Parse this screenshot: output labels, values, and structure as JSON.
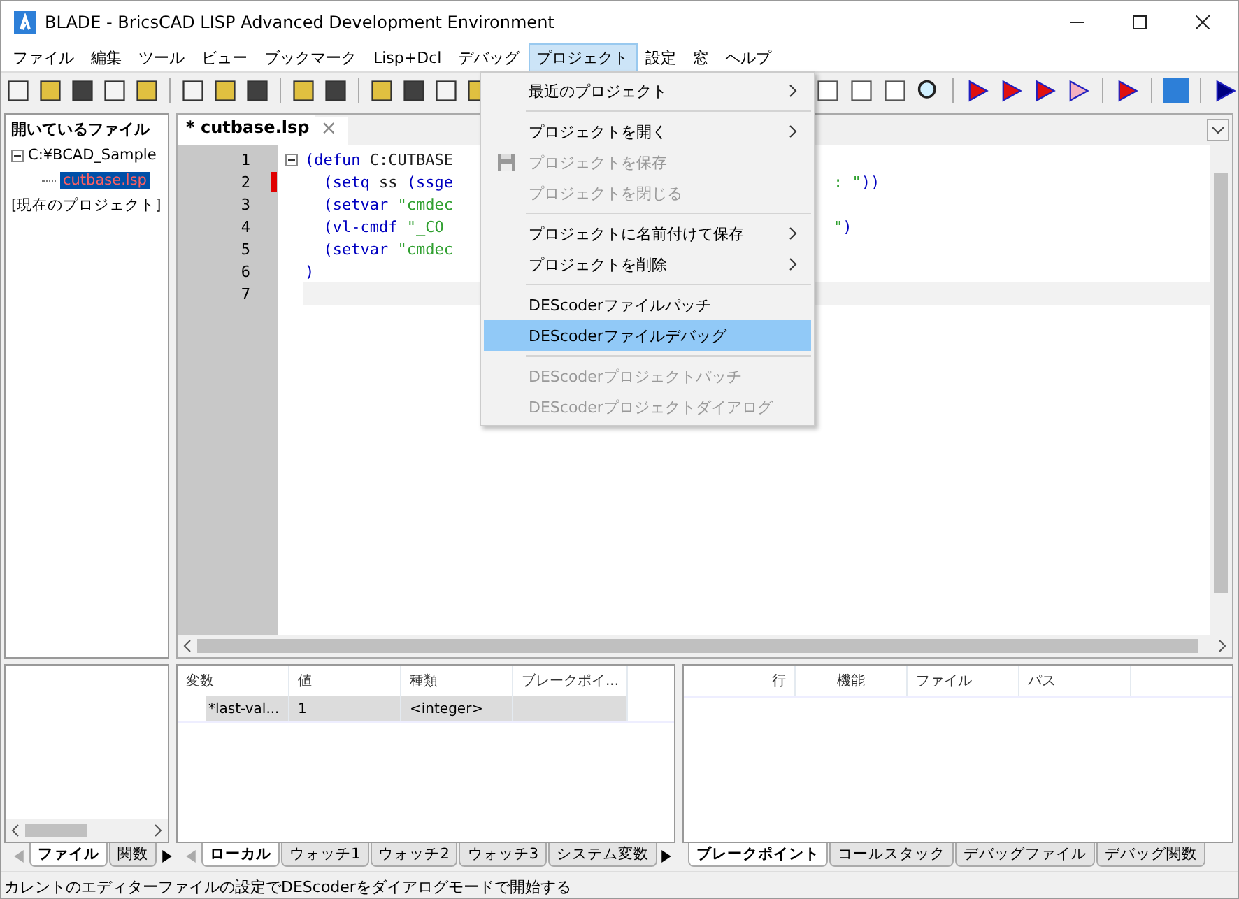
{
  "window": {
    "title": "BLADE - BricsCAD LISP Advanced Development Environment"
  },
  "menubar": [
    {
      "label": "ファイル",
      "selected": false
    },
    {
      "label": "編集",
      "selected": false
    },
    {
      "label": "ツール",
      "selected": false
    },
    {
      "label": "ビュー",
      "selected": false
    },
    {
      "label": "ブックマーク",
      "selected": false
    },
    {
      "label": "Lisp+Dcl",
      "selected": false
    },
    {
      "label": "デバッグ",
      "selected": false
    },
    {
      "label": "プロジェクト",
      "selected": true
    },
    {
      "label": "設定",
      "selected": false
    },
    {
      "label": "窓",
      "selected": false
    },
    {
      "label": "ヘルプ",
      "selected": false
    }
  ],
  "project_menu": [
    {
      "kind": "item",
      "label": "最近のプロジェクト",
      "submenu": true,
      "disabled": false,
      "selected": false,
      "icon": false
    },
    {
      "kind": "separator"
    },
    {
      "kind": "item",
      "label": "プロジェクトを開く",
      "submenu": true,
      "disabled": false,
      "selected": false,
      "icon": false
    },
    {
      "kind": "item",
      "label": "プロジェクトを保存",
      "submenu": false,
      "disabled": true,
      "selected": false,
      "icon": true
    },
    {
      "kind": "item",
      "label": "プロジェクトを閉じる",
      "submenu": false,
      "disabled": true,
      "selected": false,
      "icon": false
    },
    {
      "kind": "separator"
    },
    {
      "kind": "item",
      "label": "プロジェクトに名前付けて保存",
      "submenu": true,
      "disabled": false,
      "selected": false,
      "icon": false
    },
    {
      "kind": "item",
      "label": "プロジェクトを削除",
      "submenu": true,
      "disabled": false,
      "selected": false,
      "icon": false
    },
    {
      "kind": "separator"
    },
    {
      "kind": "item",
      "label": "DEScoderファイルパッチ",
      "submenu": false,
      "disabled": false,
      "selected": false,
      "icon": false
    },
    {
      "kind": "item",
      "label": "DEScoderファイルデバッグ",
      "submenu": false,
      "disabled": false,
      "selected": true,
      "icon": false
    },
    {
      "kind": "separator"
    },
    {
      "kind": "item",
      "label": "DEScoderプロジェクトパッチ",
      "submenu": false,
      "disabled": true,
      "selected": false,
      "icon": false
    },
    {
      "kind": "item",
      "label": "DEScoderプロジェクトダイアログ",
      "submenu": false,
      "disabled": true,
      "selected": false,
      "icon": false
    }
  ],
  "file_panel": {
    "title": "開いているファイル",
    "tree": [
      {
        "label": "C:¥BCAD_Sample",
        "expanded": true,
        "selected": false,
        "children": [
          {
            "label": "cutbase.lsp",
            "selected": true
          }
        ]
      },
      {
        "label": "[現在のプロジェクト]",
        "selected": false
      }
    ],
    "tabs": [
      {
        "label": "ファイル",
        "selected": true
      },
      {
        "label": "関数",
        "selected": false
      }
    ]
  },
  "editor": {
    "tab": {
      "label": "* cutbase.lsp",
      "close": "×"
    },
    "lines": [
      {
        "number": "1",
        "breakpoint": false,
        "current": false,
        "left": [
          {
            "kind": "paren",
            "text": "("
          },
          {
            "kind": "func",
            "text": "defun"
          },
          {
            "kind": "sym",
            "text": " C:CUTBASE"
          }
        ]
      },
      {
        "number": "2",
        "breakpoint": true,
        "current": false,
        "left": [
          {
            "kind": "paren",
            "text": "  ("
          },
          {
            "kind": "func",
            "text": "setq"
          },
          {
            "kind": "sym",
            "text": " ss "
          },
          {
            "kind": "paren",
            "text": "("
          },
          {
            "kind": "func",
            "text": "ssge"
          }
        ],
        "right": [
          {
            "kind": "str",
            "text": ": \""
          },
          {
            "kind": "paren",
            "text": "))"
          }
        ]
      },
      {
        "number": "3",
        "breakpoint": false,
        "current": false,
        "left": [
          {
            "kind": "paren",
            "text": "  ("
          },
          {
            "kind": "func",
            "text": "setvar"
          },
          {
            "kind": "str",
            "text": " \"cmdec"
          }
        ]
      },
      {
        "number": "4",
        "breakpoint": false,
        "current": false,
        "left": [
          {
            "kind": "paren",
            "text": "  ("
          },
          {
            "kind": "func",
            "text": "vl-cmdf"
          },
          {
            "kind": "str",
            "text": " \"_CO"
          }
        ],
        "right": [
          {
            "kind": "str",
            "text": "\""
          },
          {
            "kind": "paren",
            "text": ")"
          }
        ]
      },
      {
        "number": "5",
        "breakpoint": false,
        "current": false,
        "left": [
          {
            "kind": "paren",
            "text": "  ("
          },
          {
            "kind": "func",
            "text": "setvar"
          },
          {
            "kind": "str",
            "text": " \"cmdec"
          }
        ]
      },
      {
        "number": "6",
        "breakpoint": false,
        "current": false,
        "left": [
          {
            "kind": "paren",
            "text": ")"
          }
        ]
      },
      {
        "number": "7",
        "breakpoint": false,
        "current": true
      }
    ]
  },
  "locals": {
    "columns": [
      "変数",
      "値",
      "種類",
      "ブレークポイ..."
    ],
    "rows": [
      {
        "selected": true,
        "cells": [
          "*last-val...",
          "1",
          "<integer>",
          ""
        ]
      }
    ],
    "tabs": [
      {
        "label": "ローカル",
        "selected": true
      },
      {
        "label": "ウォッチ1",
        "selected": false
      },
      {
        "label": "ウォッチ2",
        "selected": false
      },
      {
        "label": "ウォッチ3",
        "selected": false
      },
      {
        "label": "システム変数",
        "selected": false
      }
    ]
  },
  "breakpoints": {
    "columns": [
      "行",
      "機能",
      "ファイル",
      "パス"
    ],
    "tabs": [
      {
        "label": "ブレークポイント",
        "selected": true
      },
      {
        "label": "コールスタック",
        "selected": false
      },
      {
        "label": "デバッグファイル",
        "selected": false
      },
      {
        "label": "デバッグ関数",
        "selected": false
      }
    ]
  },
  "status_bar": "カレントのエディターファイルの設定でDEScoderをダイアログモードで開始する"
}
